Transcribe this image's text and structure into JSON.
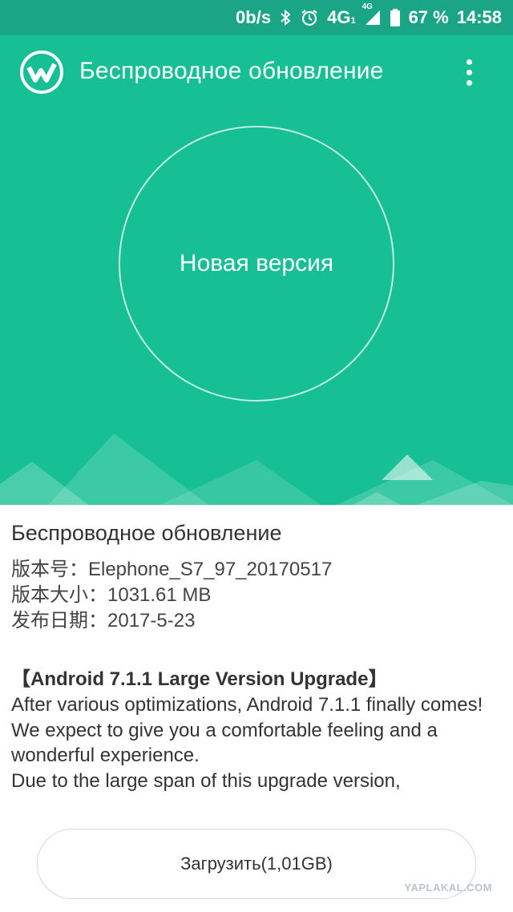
{
  "status_bar": {
    "net_speed": "0b/s",
    "network_type": "4G",
    "network_sub": "1",
    "network_type_small": "4G",
    "battery": "67 %",
    "time": "14:58",
    "icons": [
      "bluetooth-icon",
      "alarm-icon",
      "signal-icon",
      "battery-icon"
    ]
  },
  "app_bar": {
    "title": "Беспроводное обновление",
    "logo_icon": "wireless-update-logo-icon",
    "menu_icon": "more-vert-icon"
  },
  "hero": {
    "circle_label": "Новая версия",
    "bg_color": "#17bf94",
    "status_color": "#19a586"
  },
  "details": {
    "title": "Беспроводное обновление",
    "version_line": "版本号：Elephone_S7_97_20170517",
    "size_line": "版本大小：1031.61 MB",
    "date_line": "发布日期：2017-5-23"
  },
  "release_notes": {
    "heading": "【Android 7.1.1 Large Version Upgrade】",
    "lines": [
      "After various optimizations, Android 7.1.1 finally comes!",
      "We expect to give you a comfortable feeling and a wonderful experience.",
      "Due to the large span of this upgrade version,"
    ]
  },
  "download_button": {
    "label": "Загрузить(1,01GB)"
  },
  "watermark": "YAPLAKAL.COM"
}
